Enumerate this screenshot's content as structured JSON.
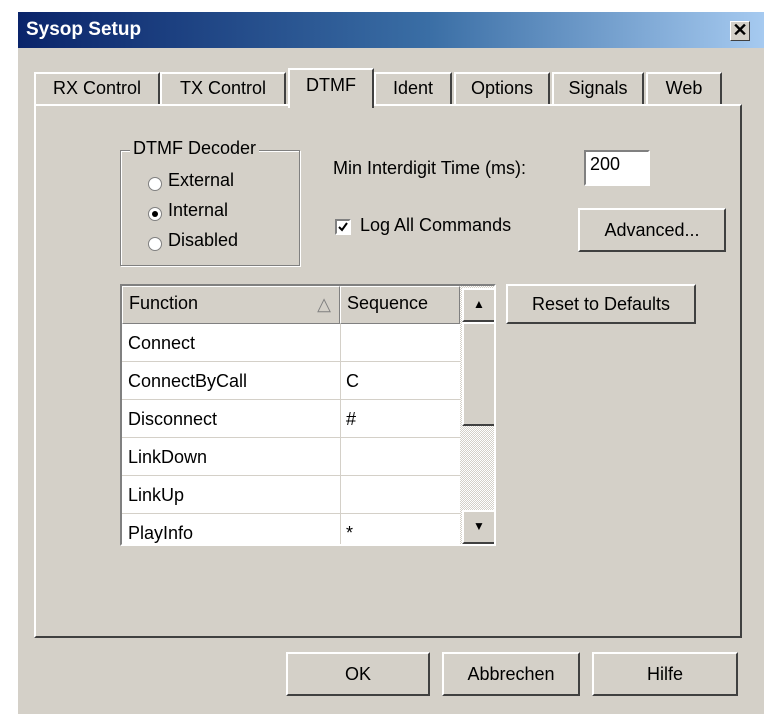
{
  "window": {
    "title": "Sysop Setup",
    "close_glyph": "✕"
  },
  "tabs": [
    {
      "label": "RX Control"
    },
    {
      "label": "TX Control"
    },
    {
      "label": "DTMF",
      "active": true
    },
    {
      "label": "Ident"
    },
    {
      "label": "Options"
    },
    {
      "label": "Signals"
    },
    {
      "label": "Web"
    }
  ],
  "dtmf_decoder": {
    "title": "DTMF Decoder",
    "options": [
      "External",
      "Internal",
      "Disabled"
    ],
    "selected": "Internal"
  },
  "min_interdigit": {
    "label": "Min Interdigit Time (ms):",
    "value": "200"
  },
  "log_all_commands": {
    "label": "Log All Commands",
    "checked": true
  },
  "buttons": {
    "advanced": "Advanced...",
    "reset": "Reset to Defaults",
    "ok": "OK",
    "cancel": "Abbrechen",
    "help": "Hilfe"
  },
  "table": {
    "headers": {
      "function": "Function",
      "sequence": "Sequence",
      "sort_glyph": "△"
    },
    "rows": [
      {
        "function": "Connect",
        "sequence": ""
      },
      {
        "function": "ConnectByCall",
        "sequence": "C"
      },
      {
        "function": "Disconnect",
        "sequence": "#"
      },
      {
        "function": "LinkDown",
        "sequence": ""
      },
      {
        "function": "LinkUp",
        "sequence": ""
      },
      {
        "function": "PlayInfo",
        "sequence": "*"
      }
    ]
  },
  "scrollbar": {
    "up_glyph": "▲",
    "down_glyph": "▼"
  },
  "colors": {
    "face": "#d4d0c8",
    "title_start": "#0a246a",
    "title_end": "#a6caf0"
  }
}
